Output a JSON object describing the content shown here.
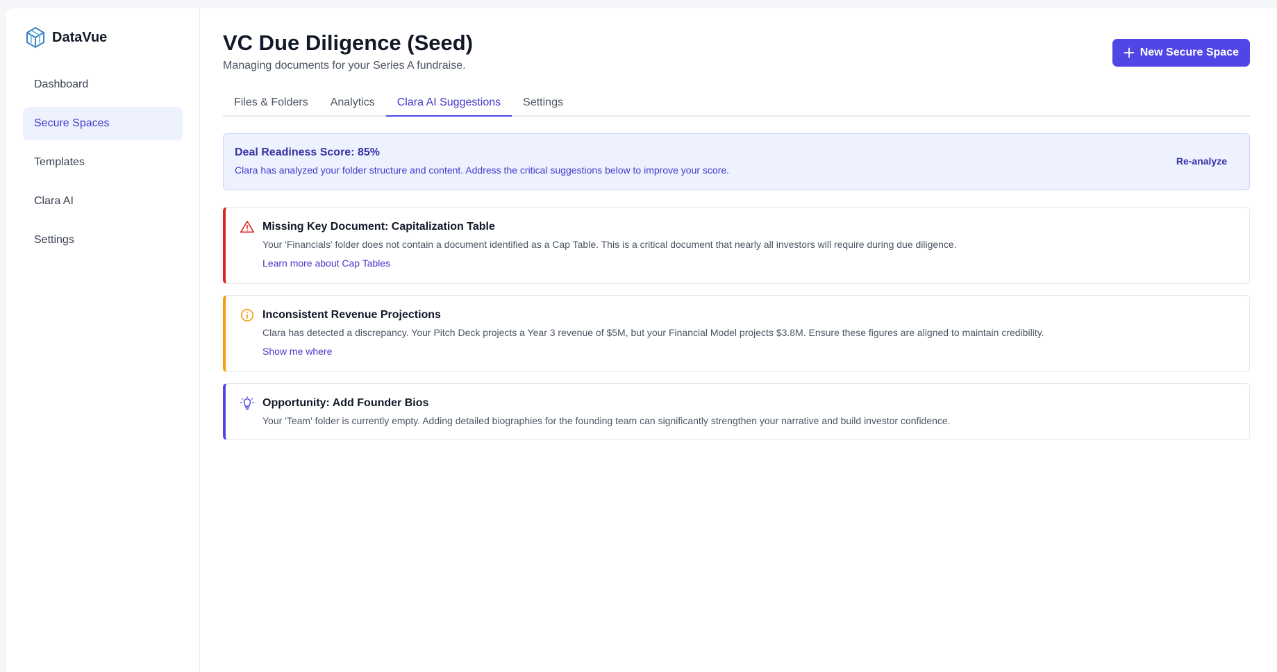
{
  "brand": {
    "name": "DataVue",
    "logo_icon": "cube-logo-icon"
  },
  "sidebar": {
    "items": [
      {
        "label": "Dashboard",
        "active": false
      },
      {
        "label": "Secure Spaces",
        "active": true
      },
      {
        "label": "Templates",
        "active": false
      },
      {
        "label": "Clara AI",
        "active": false
      },
      {
        "label": "Settings",
        "active": false
      }
    ]
  },
  "header": {
    "title": "VC Due Diligence (Seed)",
    "subtitle": "Managing documents for your Series A fundraise.",
    "new_button_label": "New Secure Space"
  },
  "tabs": [
    {
      "label": "Files & Folders",
      "active": false
    },
    {
      "label": "Analytics",
      "active": false
    },
    {
      "label": "Clara AI Suggestions",
      "active": true
    },
    {
      "label": "Settings",
      "active": false
    }
  ],
  "score": {
    "title": "Deal Readiness Score: 85%",
    "description": "Clara has analyzed your folder structure and content. Address the critical suggestions below to improve your score.",
    "reanalyze_label": "Re-analyze"
  },
  "suggestions": [
    {
      "severity": "critical",
      "icon": "warning-triangle-icon",
      "color": "#dc2626",
      "title": "Missing Key Document: Capitalization Table",
      "text": "Your 'Financials' folder does not contain a document identified as a Cap Table. This is a critical document that nearly all investors will require during due diligence.",
      "link": "Learn more about Cap Tables"
    },
    {
      "severity": "warning",
      "icon": "info-circle-icon",
      "color": "#f59e0b",
      "title": "Inconsistent Revenue Projections",
      "text": "Clara has detected a discrepancy. Your Pitch Deck projects a Year 3 revenue of $5M, but your Financial Model projects $3.8M. Ensure these figures are aligned to maintain credibility.",
      "link": "Show me where"
    },
    {
      "severity": "opportunity",
      "icon": "lightbulb-icon",
      "color": "#4f46e5",
      "title": "Opportunity: Add Founder Bios",
      "text": "Your 'Team' folder is currently empty. Adding detailed biographies for the founding team can significantly strengthen your narrative and build investor confidence."
    }
  ],
  "colors": {
    "accent": "#4f46e5",
    "accent_soft": "#eef2ff"
  }
}
